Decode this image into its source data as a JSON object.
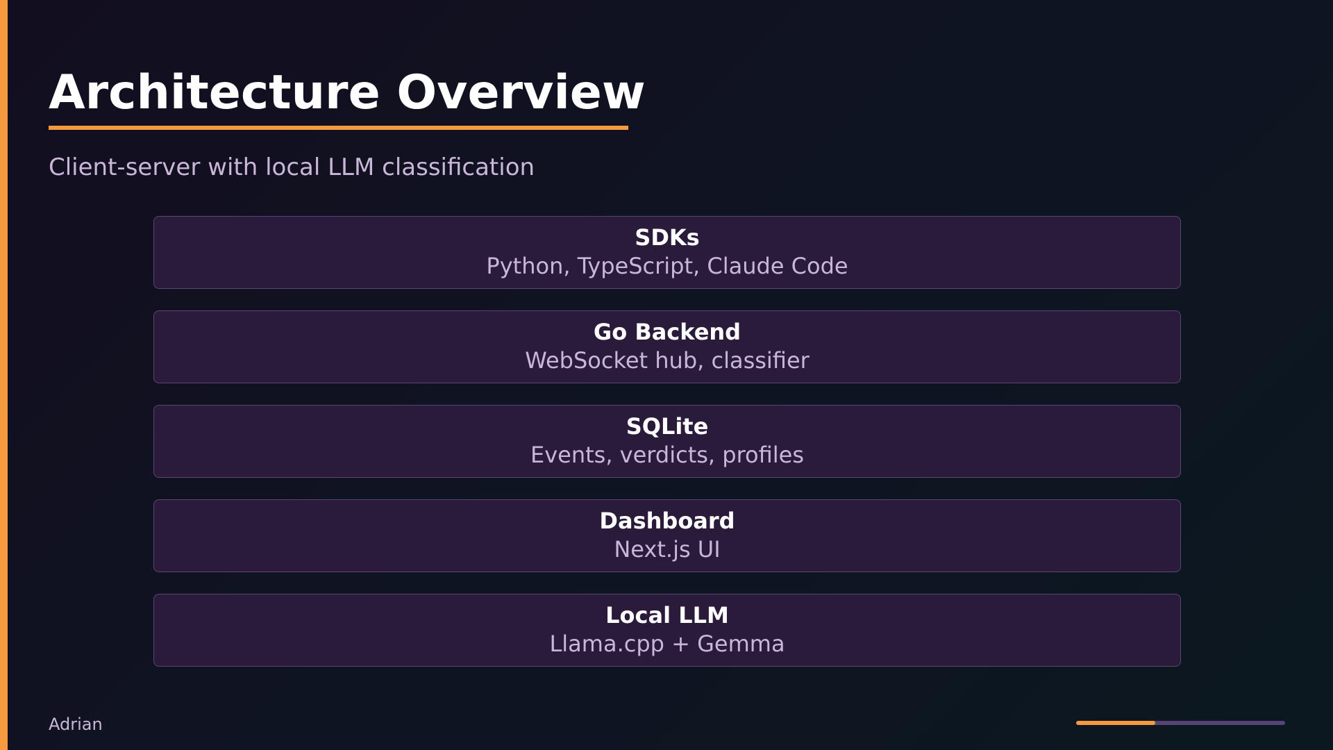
{
  "slide": {
    "title": "Architecture Overview",
    "subtitle": "Client-server with local LLM classification",
    "author": "Adrian",
    "progress": 0.38
  },
  "layers": [
    {
      "name": "SDKs",
      "description": "Python, TypeScript, Claude Code"
    },
    {
      "name": "Go Backend",
      "description": "WebSocket hub, classifier"
    },
    {
      "name": "SQLite",
      "description": "Events, verdicts, profiles"
    },
    {
      "name": "Dashboard",
      "description": "Next.js UI"
    },
    {
      "name": "Local LLM",
      "description": "Llama.cpp + Gemma"
    }
  ],
  "colors": {
    "accent": "#f59a3e",
    "card_background": "#2a1b3b",
    "card_border": "#5a4674",
    "muted_text": "#c9b6d8",
    "progress_track": "#564476"
  }
}
